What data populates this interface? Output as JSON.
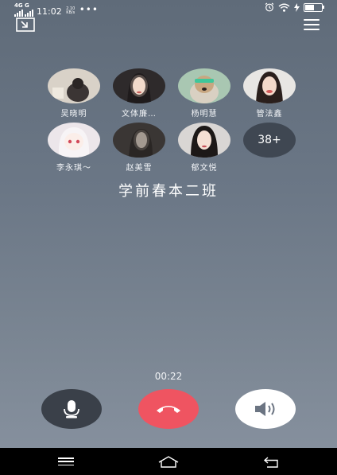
{
  "status_bar": {
    "network": "4G",
    "network_sub": "G",
    "time": "11:02",
    "speed": "2.10 KB/s",
    "dots": "•••",
    "battery_level": 0.6,
    "icons": [
      "alarm-icon",
      "wifi-icon",
      "charging-icon",
      "battery-icon"
    ]
  },
  "toolbar": {
    "minimize_icon": "minimize-window-icon",
    "menu_icon": "hamburger-menu-icon"
  },
  "members": [
    {
      "name": "吴晓明"
    },
    {
      "name": "文体廉…"
    },
    {
      "name": "杨明慧"
    },
    {
      "name": "管法鑫"
    },
    {
      "name": "李永琪～"
    },
    {
      "name": "赵美雪"
    },
    {
      "name": "郁文悦"
    }
  ],
  "more_count": "38+",
  "group_name": "学前春本二班",
  "call": {
    "duration": "00:22"
  },
  "controls": {
    "mic_icon": "microphone-icon",
    "hangup_icon": "hang-up-icon",
    "speaker_icon": "speaker-icon"
  },
  "colors": {
    "hangup": "#ef5461",
    "mic_bg": "#3a4049",
    "speaker_bg": "#ffffff"
  },
  "nav_bar": {
    "icons": [
      "recent-apps-icon",
      "home-icon",
      "back-icon"
    ]
  }
}
